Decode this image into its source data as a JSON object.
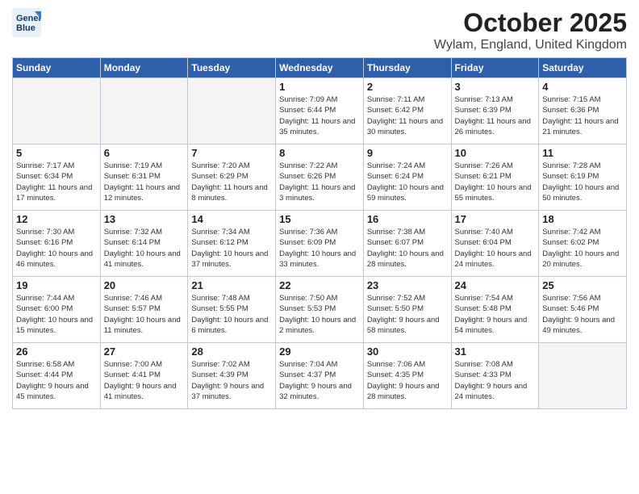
{
  "header": {
    "logo_line1": "General",
    "logo_line2": "Blue",
    "month": "October 2025",
    "location": "Wylam, England, United Kingdom"
  },
  "weekdays": [
    "Sunday",
    "Monday",
    "Tuesday",
    "Wednesday",
    "Thursday",
    "Friday",
    "Saturday"
  ],
  "weeks": [
    [
      {
        "day": "",
        "sunrise": "",
        "sunset": "",
        "daylight": ""
      },
      {
        "day": "",
        "sunrise": "",
        "sunset": "",
        "daylight": ""
      },
      {
        "day": "",
        "sunrise": "",
        "sunset": "",
        "daylight": ""
      },
      {
        "day": "1",
        "sunrise": "Sunrise: 7:09 AM",
        "sunset": "Sunset: 6:44 PM",
        "daylight": "Daylight: 11 hours and 35 minutes."
      },
      {
        "day": "2",
        "sunrise": "Sunrise: 7:11 AM",
        "sunset": "Sunset: 6:42 PM",
        "daylight": "Daylight: 11 hours and 30 minutes."
      },
      {
        "day": "3",
        "sunrise": "Sunrise: 7:13 AM",
        "sunset": "Sunset: 6:39 PM",
        "daylight": "Daylight: 11 hours and 26 minutes."
      },
      {
        "day": "4",
        "sunrise": "Sunrise: 7:15 AM",
        "sunset": "Sunset: 6:36 PM",
        "daylight": "Daylight: 11 hours and 21 minutes."
      }
    ],
    [
      {
        "day": "5",
        "sunrise": "Sunrise: 7:17 AM",
        "sunset": "Sunset: 6:34 PM",
        "daylight": "Daylight: 11 hours and 17 minutes."
      },
      {
        "day": "6",
        "sunrise": "Sunrise: 7:19 AM",
        "sunset": "Sunset: 6:31 PM",
        "daylight": "Daylight: 11 hours and 12 minutes."
      },
      {
        "day": "7",
        "sunrise": "Sunrise: 7:20 AM",
        "sunset": "Sunset: 6:29 PM",
        "daylight": "Daylight: 11 hours and 8 minutes."
      },
      {
        "day": "8",
        "sunrise": "Sunrise: 7:22 AM",
        "sunset": "Sunset: 6:26 PM",
        "daylight": "Daylight: 11 hours and 3 minutes."
      },
      {
        "day": "9",
        "sunrise": "Sunrise: 7:24 AM",
        "sunset": "Sunset: 6:24 PM",
        "daylight": "Daylight: 10 hours and 59 minutes."
      },
      {
        "day": "10",
        "sunrise": "Sunrise: 7:26 AM",
        "sunset": "Sunset: 6:21 PM",
        "daylight": "Daylight: 10 hours and 55 minutes."
      },
      {
        "day": "11",
        "sunrise": "Sunrise: 7:28 AM",
        "sunset": "Sunset: 6:19 PM",
        "daylight": "Daylight: 10 hours and 50 minutes."
      }
    ],
    [
      {
        "day": "12",
        "sunrise": "Sunrise: 7:30 AM",
        "sunset": "Sunset: 6:16 PM",
        "daylight": "Daylight: 10 hours and 46 minutes."
      },
      {
        "day": "13",
        "sunrise": "Sunrise: 7:32 AM",
        "sunset": "Sunset: 6:14 PM",
        "daylight": "Daylight: 10 hours and 41 minutes."
      },
      {
        "day": "14",
        "sunrise": "Sunrise: 7:34 AM",
        "sunset": "Sunset: 6:12 PM",
        "daylight": "Daylight: 10 hours and 37 minutes."
      },
      {
        "day": "15",
        "sunrise": "Sunrise: 7:36 AM",
        "sunset": "Sunset: 6:09 PM",
        "daylight": "Daylight: 10 hours and 33 minutes."
      },
      {
        "day": "16",
        "sunrise": "Sunrise: 7:38 AM",
        "sunset": "Sunset: 6:07 PM",
        "daylight": "Daylight: 10 hours and 28 minutes."
      },
      {
        "day": "17",
        "sunrise": "Sunrise: 7:40 AM",
        "sunset": "Sunset: 6:04 PM",
        "daylight": "Daylight: 10 hours and 24 minutes."
      },
      {
        "day": "18",
        "sunrise": "Sunrise: 7:42 AM",
        "sunset": "Sunset: 6:02 PM",
        "daylight": "Daylight: 10 hours and 20 minutes."
      }
    ],
    [
      {
        "day": "19",
        "sunrise": "Sunrise: 7:44 AM",
        "sunset": "Sunset: 6:00 PM",
        "daylight": "Daylight: 10 hours and 15 minutes."
      },
      {
        "day": "20",
        "sunrise": "Sunrise: 7:46 AM",
        "sunset": "Sunset: 5:57 PM",
        "daylight": "Daylight: 10 hours and 11 minutes."
      },
      {
        "day": "21",
        "sunrise": "Sunrise: 7:48 AM",
        "sunset": "Sunset: 5:55 PM",
        "daylight": "Daylight: 10 hours and 6 minutes."
      },
      {
        "day": "22",
        "sunrise": "Sunrise: 7:50 AM",
        "sunset": "Sunset: 5:53 PM",
        "daylight": "Daylight: 10 hours and 2 minutes."
      },
      {
        "day": "23",
        "sunrise": "Sunrise: 7:52 AM",
        "sunset": "Sunset: 5:50 PM",
        "daylight": "Daylight: 9 hours and 58 minutes."
      },
      {
        "day": "24",
        "sunrise": "Sunrise: 7:54 AM",
        "sunset": "Sunset: 5:48 PM",
        "daylight": "Daylight: 9 hours and 54 minutes."
      },
      {
        "day": "25",
        "sunrise": "Sunrise: 7:56 AM",
        "sunset": "Sunset: 5:46 PM",
        "daylight": "Daylight: 9 hours and 49 minutes."
      }
    ],
    [
      {
        "day": "26",
        "sunrise": "Sunrise: 6:58 AM",
        "sunset": "Sunset: 4:44 PM",
        "daylight": "Daylight: 9 hours and 45 minutes."
      },
      {
        "day": "27",
        "sunrise": "Sunrise: 7:00 AM",
        "sunset": "Sunset: 4:41 PM",
        "daylight": "Daylight: 9 hours and 41 minutes."
      },
      {
        "day": "28",
        "sunrise": "Sunrise: 7:02 AM",
        "sunset": "Sunset: 4:39 PM",
        "daylight": "Daylight: 9 hours and 37 minutes."
      },
      {
        "day": "29",
        "sunrise": "Sunrise: 7:04 AM",
        "sunset": "Sunset: 4:37 PM",
        "daylight": "Daylight: 9 hours and 32 minutes."
      },
      {
        "day": "30",
        "sunrise": "Sunrise: 7:06 AM",
        "sunset": "Sunset: 4:35 PM",
        "daylight": "Daylight: 9 hours and 28 minutes."
      },
      {
        "day": "31",
        "sunrise": "Sunrise: 7:08 AM",
        "sunset": "Sunset: 4:33 PM",
        "daylight": "Daylight: 9 hours and 24 minutes."
      },
      {
        "day": "",
        "sunrise": "",
        "sunset": "",
        "daylight": ""
      }
    ]
  ]
}
